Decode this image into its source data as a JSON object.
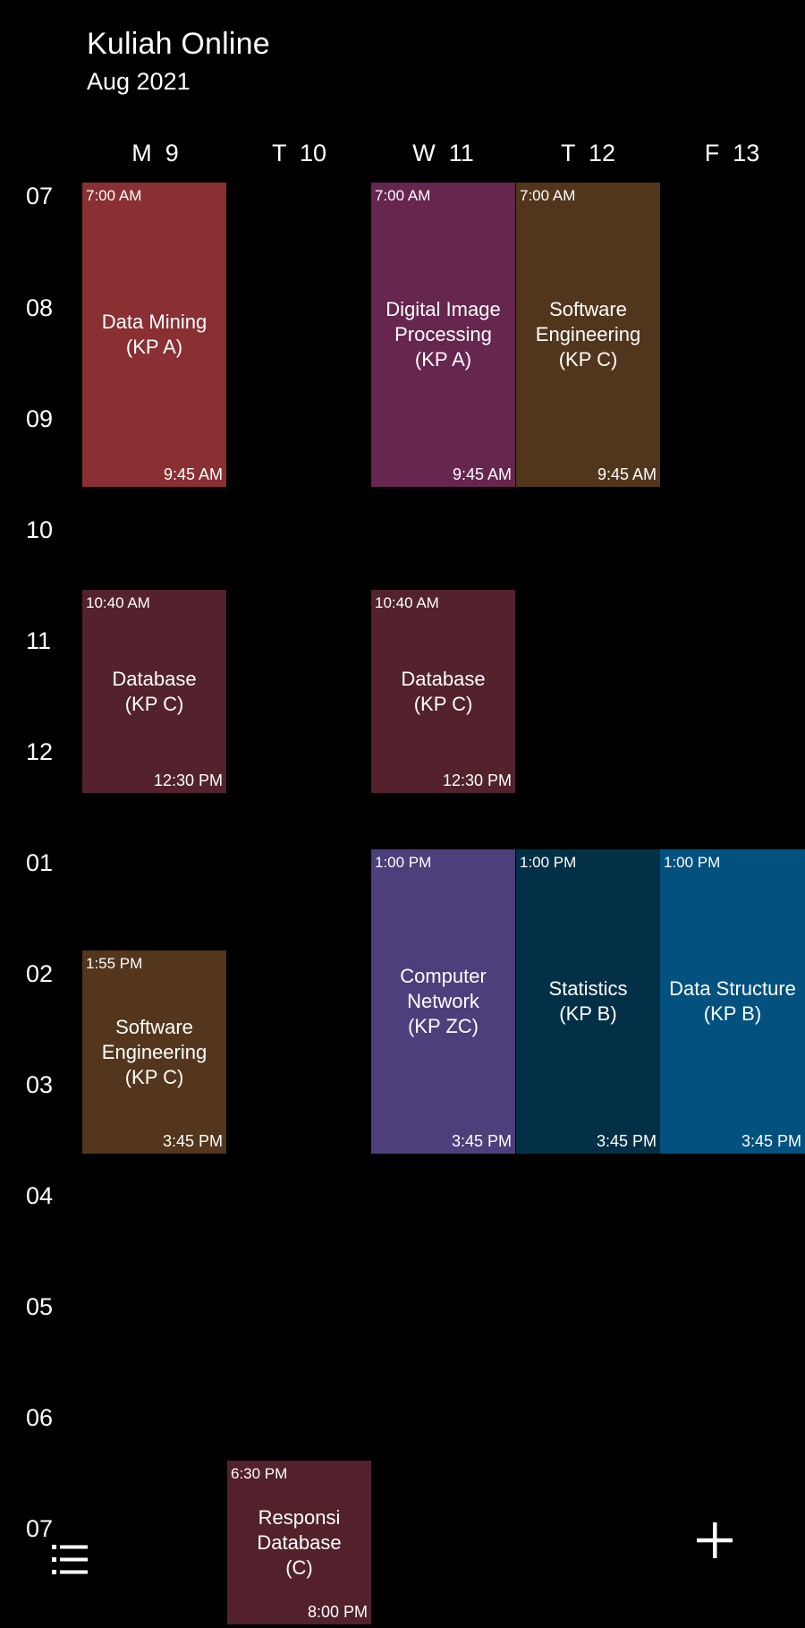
{
  "header": {
    "title": "Kuliah Online",
    "subtitle": "Aug 2021"
  },
  "days": [
    {
      "label": "M  9"
    },
    {
      "label": "T  10"
    },
    {
      "label": "W  11"
    },
    {
      "label": "T  12"
    },
    {
      "label": "F  13"
    }
  ],
  "hours": [
    "07",
    "08",
    "09",
    "10",
    "11",
    "12",
    "01",
    "02",
    "03",
    "04",
    "05",
    "06",
    "07"
  ],
  "events": [
    {
      "start": "7:00 AM",
      "end": "9:45 AM",
      "title": "Data Mining\n(KP A)",
      "color": "#8a2f32"
    },
    {
      "start": "7:00 AM",
      "end": "9:45 AM",
      "title": "Digital Image\nProcessing\n(KP A)",
      "color": "#66264f"
    },
    {
      "start": "7:00 AM",
      "end": "9:45 AM",
      "title": "Software\nEngineering\n(KP C)",
      "color": "#51361c"
    },
    {
      "start": "10:40 AM",
      "end": "12:30 PM",
      "title": "Database\n(KP C)",
      "color": "#53222c"
    },
    {
      "start": "10:40 AM",
      "end": "12:30 PM",
      "title": "Database\n(KP C)",
      "color": "#53222c"
    },
    {
      "start": "1:00 PM",
      "end": "3:45 PM",
      "title": "Computer\nNetwork\n(KP ZC)",
      "color": "#4c3f7b"
    },
    {
      "start": "1:00 PM",
      "end": "3:45 PM",
      "title": "Statistics\n(KP B)",
      "color": "#033046"
    },
    {
      "start": "1:00 PM",
      "end": "3:45 PM",
      "title": "Data Structure\n(KP B)",
      "color": "#03517f"
    },
    {
      "start": "1:55 PM",
      "end": "3:45 PM",
      "title": "Software\nEngineering\n(KP C)",
      "color": "#53361c"
    },
    {
      "start": "6:30 PM",
      "end": "8:00 PM",
      "title": "Responsi\nDatabase\n(C)",
      "color": "#52212b"
    }
  ],
  "actions": {
    "list_icon": "list-icon",
    "add_icon": "plus-icon"
  }
}
